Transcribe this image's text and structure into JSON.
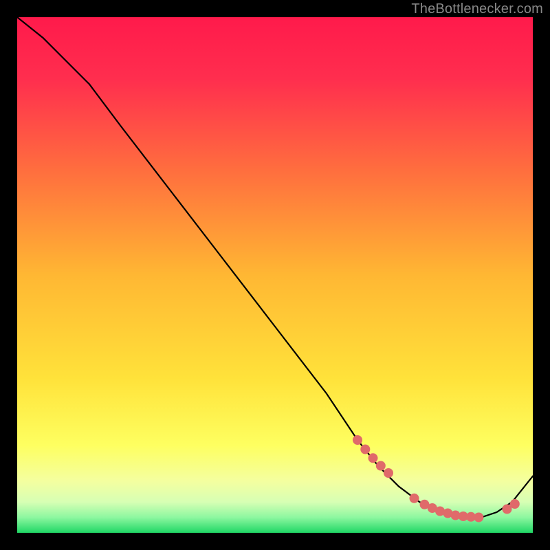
{
  "attribution": "TheBottlenecker.com",
  "chart_data": {
    "type": "line",
    "title": "",
    "xlabel": "",
    "ylabel": "",
    "xlim": [
      0,
      100
    ],
    "ylim": [
      0,
      100
    ],
    "background_gradient": {
      "top": "#ff2050",
      "mid": "#ffd500",
      "bottom_band": "#f6ff9e",
      "base": "#27d76a"
    },
    "series": [
      {
        "name": "curve",
        "x": [
          0,
          5,
          9,
          14,
          20,
          30,
          40,
          50,
          60,
          66,
          70,
          74,
          78,
          82,
          86,
          90,
          93,
          96,
          100
        ],
        "y": [
          100,
          96,
          92,
          87,
          79,
          66,
          53,
          40,
          27,
          18,
          13,
          9,
          6,
          4,
          3,
          3,
          4,
          6,
          11
        ]
      }
    ],
    "highlight_points": {
      "color": "#e06a6a",
      "x": [
        66,
        67.5,
        69,
        70.5,
        72,
        77,
        79,
        80.5,
        82,
        83.5,
        85,
        86.5,
        88,
        89.5,
        95,
        96.5
      ],
      "y": [
        18,
        16.2,
        14.5,
        13,
        11.6,
        6.7,
        5.5,
        4.8,
        4.2,
        3.8,
        3.4,
        3.2,
        3.1,
        3.0,
        4.6,
        5.6
      ]
    }
  }
}
